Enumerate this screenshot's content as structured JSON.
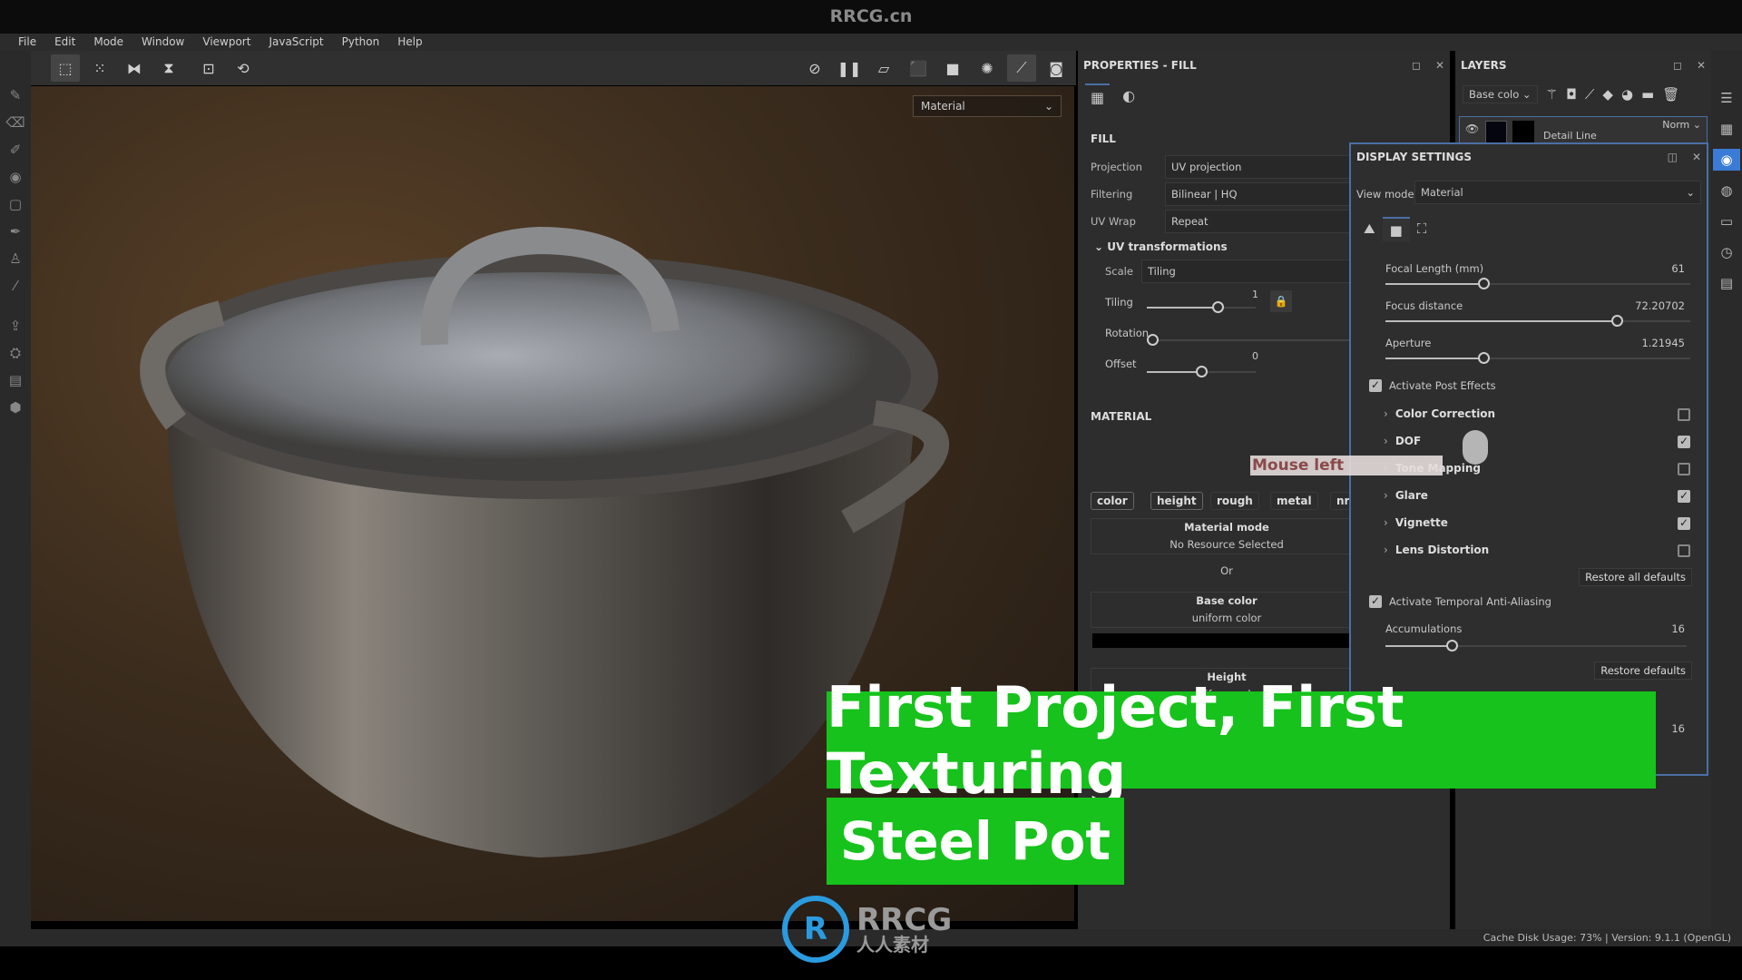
{
  "title": "RRCG.cn",
  "menu": [
    "File",
    "Edit",
    "Mode",
    "Window",
    "Viewport",
    "JavaScript",
    "Python",
    "Help"
  ],
  "viewport": {
    "view_select": "Material"
  },
  "properties": {
    "title": "PROPERTIES - FILL",
    "fill_heading": "FILL",
    "projection_label": "Projection",
    "projection": "UV projection",
    "filtering_label": "Filtering",
    "filtering": "Bilinear | HQ",
    "uvwrap_label": "UV Wrap",
    "uvwrap": "Repeat",
    "uvtrans": "UV transformations",
    "scale_label": "Scale",
    "scale": "Tiling",
    "tiling_label": "Tiling",
    "tiling": "1",
    "rotation_label": "Rotation",
    "offset_label": "Offset",
    "offset": "0",
    "material_heading": "MATERIAL",
    "channels": [
      "color",
      "height",
      "rough",
      "metal",
      "nrm"
    ],
    "material_mode": "Material mode",
    "no_resource": "No Resource Selected",
    "or": "Or",
    "base_color": "Base color",
    "base_color_sub": "uniform color",
    "base_color_value": "#000000",
    "height": "Height",
    "height_sub": "uniform color"
  },
  "layers": {
    "title": "LAYERS",
    "channel_select": "Base colo",
    "blend": "Norm",
    "layer_name": "Detail Line"
  },
  "display": {
    "title": "DISPLAY SETTINGS",
    "view_mode_label": "View mode",
    "view_mode": "Material",
    "focal_label": "Focal Length (mm)",
    "focal": "61",
    "focus_label": "Focus distance",
    "focus": "72.20702",
    "aperture_label": "Aperture",
    "aperture": "1.21945",
    "post_label": "Activate Post Effects",
    "effects": [
      {
        "name": "Color Correction",
        "on": false
      },
      {
        "name": "DOF",
        "on": true
      },
      {
        "name": "Tone Mapping",
        "on": false
      },
      {
        "name": "Glare",
        "on": true
      },
      {
        "name": "Vignette",
        "on": true
      },
      {
        "name": "Lens Distortion",
        "on": false
      }
    ],
    "restore_all": "Restore all defaults",
    "taa_label": "Activate Temporal Anti-Aliasing",
    "accum_label": "Accumulations",
    "accum": "16",
    "restore": "Restore defaults",
    "accum2": "16"
  },
  "tooltip": "Mouse left",
  "status": "Cache Disk Usage:    73% | Version: 9.1.1 (OpenGL)",
  "banner1": "First Project, First Texturing",
  "banner2": "Steel Pot",
  "logo": {
    "text": "RRCG",
    "sub": "人人素材"
  },
  "colors": {
    "accent": "#3a7bd5",
    "banner": "#16c21b"
  }
}
